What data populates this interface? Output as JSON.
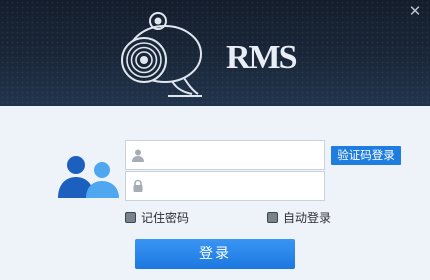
{
  "header": {
    "logo_text": "RMS",
    "close_symbol": "✕",
    "logo_icon": "webcam-icon"
  },
  "form": {
    "username": {
      "icon": "user-icon",
      "value": "",
      "placeholder": ""
    },
    "password": {
      "icon": "lock-icon",
      "value": "",
      "placeholder": ""
    },
    "verification_login_label": "验证码登录",
    "remember_password_label": "记住密码",
    "remember_password_checked": false,
    "auto_login_label": "自动登录",
    "auto_login_checked": false,
    "login_button_label": "登录"
  },
  "illustration": {
    "icon": "users-icon"
  },
  "colors": {
    "header_bg": "#1a2739",
    "content_bg": "#eef3fa",
    "accent": "#1f7de0",
    "users_dark": "#1c5fbf",
    "users_light": "#4ea7ef"
  }
}
